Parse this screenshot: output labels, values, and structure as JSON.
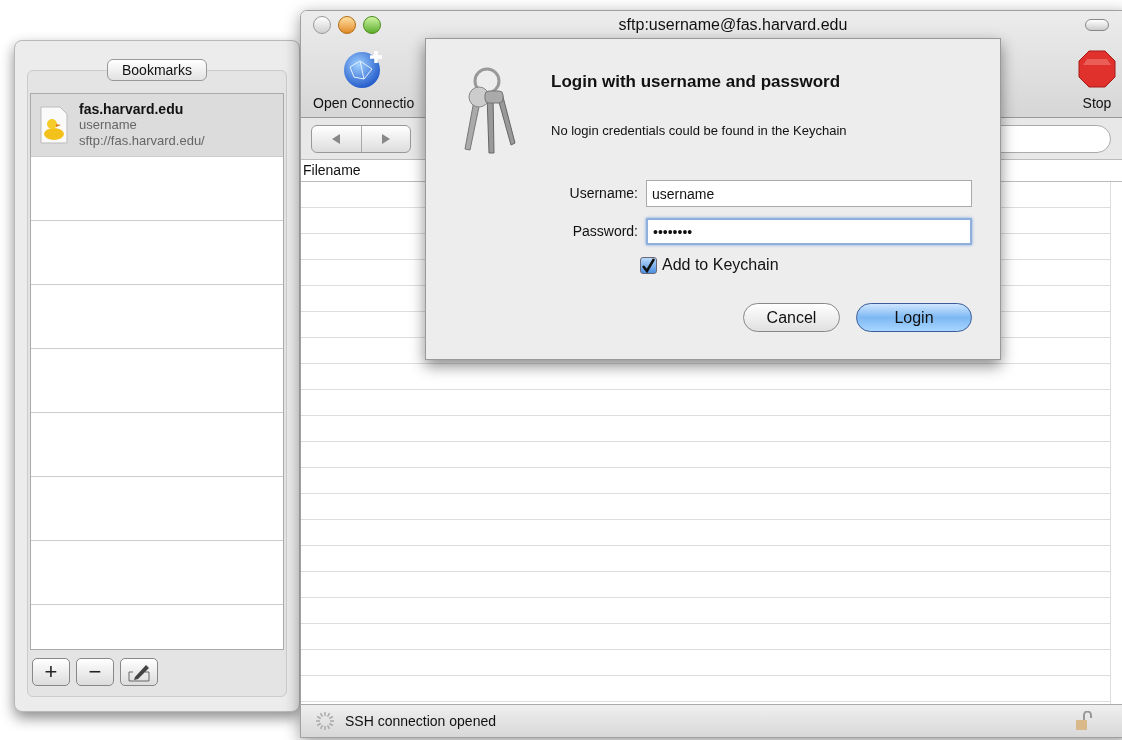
{
  "bookmarks_drawer": {
    "title": "Bookmarks",
    "items": [
      {
        "name": "fas.harvard.edu",
        "user": "username",
        "url": "sftp://fas.harvard.edu/",
        "selected": true
      }
    ],
    "buttons": [
      {
        "kind": "add",
        "label": "+"
      },
      {
        "kind": "remove",
        "label": "−"
      },
      {
        "kind": "edit"
      }
    ]
  },
  "window": {
    "title": "sftp:username@fas.harvard.edu"
  },
  "toolbar": [
    {
      "kind": "open",
      "label": "Open Connectio"
    },
    {
      "kind": "stop",
      "label": "Stop"
    }
  ],
  "file_list": {
    "columns": [
      "Filename"
    ]
  },
  "status_bar": {
    "text": "SSH connection opened"
  },
  "login_sheet": {
    "title": "Login with username and password",
    "message": "No login credentials could be found in the Keychain",
    "fields": [
      {
        "label": "Username:",
        "value": "username",
        "focused": false
      },
      {
        "label": "Password:",
        "value": "••••••••",
        "focused": true
      }
    ],
    "remember": {
      "label": "Add to Keychain",
      "checked": true
    },
    "buttons": [
      {
        "label": "Cancel",
        "default": false
      },
      {
        "label": "Login",
        "default": true
      }
    ]
  }
}
